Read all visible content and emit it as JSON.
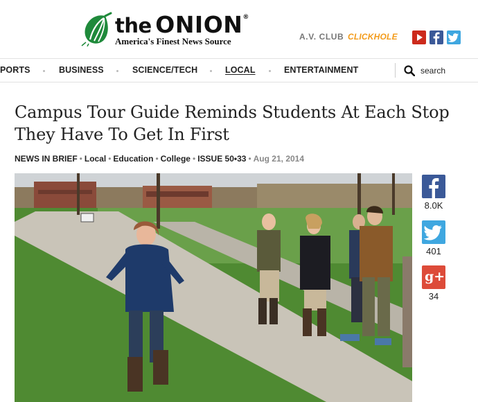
{
  "header": {
    "logo_the": "the",
    "logo_onion": "ONION",
    "logo_reg": "®",
    "tagline": "America's Finest News Source",
    "sister_sites": [
      "A.V. CLUB",
      "CLICKHOLE"
    ],
    "social_icons": [
      "youtube-icon",
      "facebook-icon",
      "twitter-icon"
    ],
    "colors": {
      "youtube": "#cc2a1c",
      "facebook": "#3b5998",
      "twitter": "#3fa7e0",
      "clickhole": "#f39b1a",
      "logo_green": "#1f8a3b"
    }
  },
  "nav": {
    "items": [
      "PORTS",
      "BUSINESS",
      "SCIENCE/TECH",
      "LOCAL",
      "ENTERTAINMENT"
    ],
    "active": "LOCAL",
    "search_label": "search"
  },
  "article": {
    "headline": "Campus Tour Guide Reminds Students At Each Stop They Have To Get In First",
    "meta": {
      "section": "NEWS IN BRIEF",
      "tags": [
        "Local",
        "Education",
        "College"
      ],
      "issue": "ISSUE 50•33",
      "date": "Aug 21, 2014"
    }
  },
  "share": {
    "facebook_count": "8.0K",
    "twitter_count": "401",
    "googleplus_count": "34",
    "googleplus_label": "g+",
    "colors": {
      "facebook": "#3b5998",
      "twitter": "#3fa7e0",
      "googleplus": "#dd4b39"
    }
  }
}
